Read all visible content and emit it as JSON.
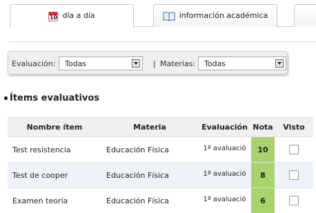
{
  "tabs": [
    {
      "label": "día a día",
      "icon": "calendar-icon",
      "icon_text": "10",
      "active": true
    },
    {
      "label": "información académica",
      "icon": "book-icon",
      "active": false
    }
  ],
  "filters": {
    "evaluacion_label": "Evaluación:",
    "evaluacion_value": "Todas",
    "separator": "|",
    "materias_label": "Materias:",
    "materias_value": "Todas"
  },
  "section": {
    "title": "Ítems evaluativos"
  },
  "table": {
    "headers": [
      "Nombre ítem",
      "Materia",
      "Evaluación",
      "Nota",
      "Visto"
    ],
    "rows": [
      {
        "nombre": "Test resistencia",
        "materia": "Educación Física",
        "evaluacion": "1ª avaluació",
        "nota": "10",
        "visto": false
      },
      {
        "nombre": "Test de cooper",
        "materia": "Educación Física",
        "evaluacion": "1ª avaluació",
        "nota": "8",
        "visto": false
      },
      {
        "nombre": "Examen teoría",
        "materia": "Educación Física",
        "evaluacion": "1ª avaluació",
        "nota": "6",
        "visto": false
      }
    ]
  },
  "colors": {
    "nota_bg": "#a9d46b",
    "row_alt": "#eef2fa",
    "tab_border": "#c9c9c9"
  }
}
